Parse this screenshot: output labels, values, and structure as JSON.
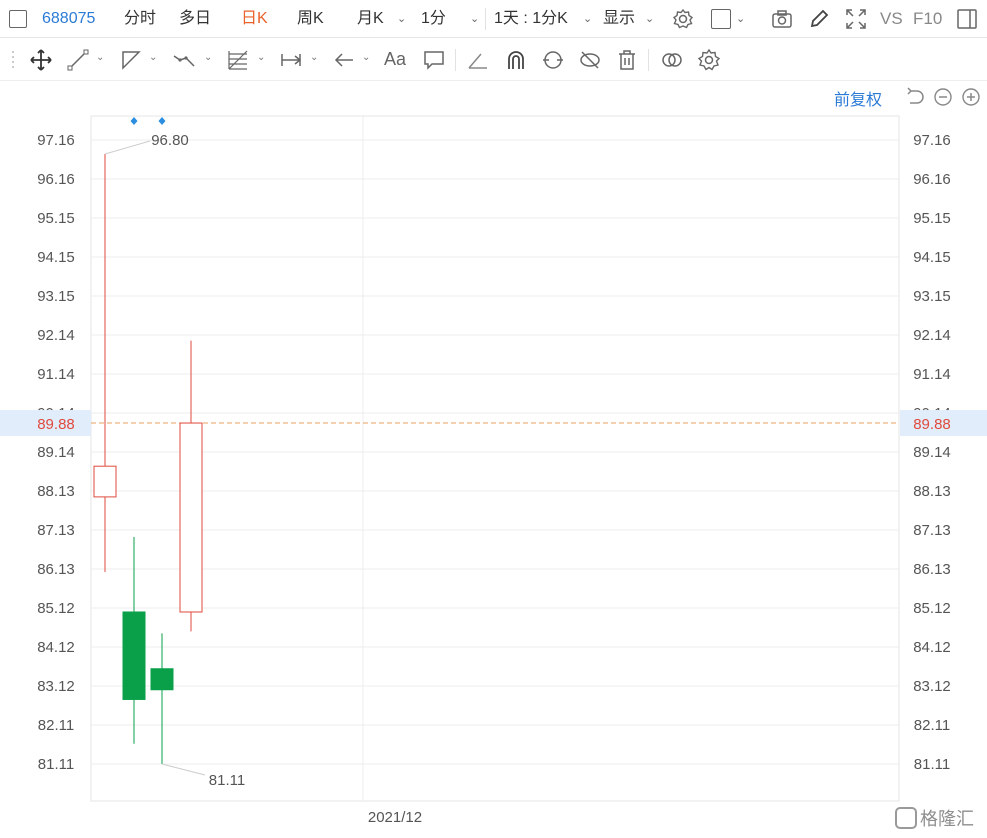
{
  "topbar": {
    "code": "688075",
    "items": [
      "分时",
      "多日",
      "日K",
      "周K",
      "月K",
      "1分",
      "1天 : 1分K",
      "显示",
      "VS",
      "F10"
    ],
    "active": "日K"
  },
  "toolbar2": {
    "font_label": "Aa"
  },
  "adjust_label": "前复权",
  "watermark": "格隆汇",
  "chart_data": {
    "type": "candlestick",
    "y_ticks": [
      "97.16",
      "96.16",
      "95.15",
      "94.15",
      "93.15",
      "92.14",
      "91.14",
      "90.14",
      "89.14",
      "88.13",
      "87.13",
      "86.13",
      "85.12",
      "84.12",
      "83.12",
      "82.11",
      "81.11"
    ],
    "ylim": [
      80.1,
      98.1
    ],
    "x_label": "2021/12",
    "current_price": 89.88,
    "high_label": "96.80",
    "low_label": "81.11",
    "candles": [
      {
        "open": 87.98,
        "close": 88.77,
        "high": 96.8,
        "low": 86.05
      },
      {
        "open": 85.02,
        "close": 82.77,
        "high": 86.95,
        "low": 81.63
      },
      {
        "open": 83.56,
        "close": 83.02,
        "high": 84.47,
        "low": 81.11
      },
      {
        "open": 85.02,
        "close": 89.88,
        "high": 92.0,
        "low": 84.52
      }
    ],
    "colors": {
      "up": "#e04a3c",
      "down": "#0aa04a",
      "price_line": "#e8a060",
      "price_text": "#e04a3c",
      "grid": "#ececec",
      "axis_text": "#555555",
      "marker": "#2b8ee0"
    }
  }
}
